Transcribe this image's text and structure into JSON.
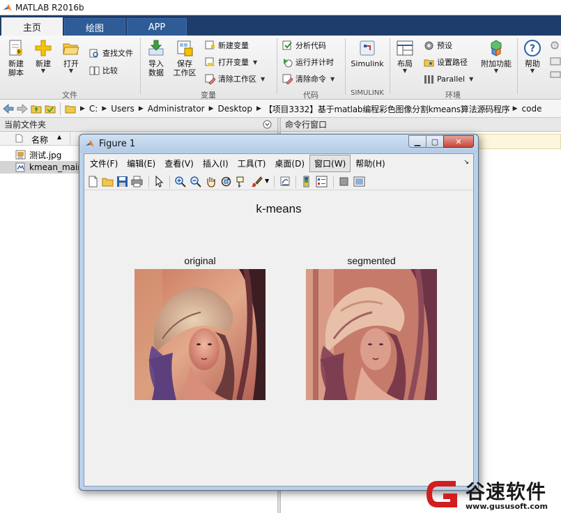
{
  "app": {
    "title": "MATLAB R2016b"
  },
  "ribbon_tabs": [
    "主页",
    "绘图",
    "APP"
  ],
  "ribbon": {
    "new_script": "新建\n脚本",
    "new": "新建",
    "open": "打开",
    "find_files": "查找文件",
    "compare": "比较",
    "group_file": "文件",
    "import_data": "导入\n数据",
    "save_workspace": "保存\n工作区",
    "new_variable": "新建变量",
    "open_variable": "打开变量",
    "clear_workspace": "清除工作区",
    "group_variable": "变量",
    "analyze_code": "分析代码",
    "run_and_time": "运行并计时",
    "clear_commands": "清除命令",
    "group_code": "代码",
    "simulink": "Simulink",
    "group_simulink": "SIMULINK",
    "layout": "布局",
    "preferences": "预设",
    "set_path": "设置路径",
    "parallel": "Parallel",
    "group_environment": "环境",
    "addons": "附加功能",
    "help": "帮助"
  },
  "address": {
    "crumbs": [
      "C:",
      "Users",
      "Administrator",
      "Desktop",
      "【项目3332】基于matlab编程彩色图像分割kmeans算法源码程序",
      "code"
    ]
  },
  "file_browser": {
    "title": "当前文件夹",
    "column_name": "名称",
    "files": [
      {
        "name": "测试.jpg",
        "icon": "jpg-file-icon"
      },
      {
        "name": "kmean_main",
        "icon": "m-file-icon"
      }
    ]
  },
  "command_window": {
    "title": "命令行窗口"
  },
  "figure": {
    "title": "Figure 1",
    "menu": [
      "文件(F)",
      "编辑(E)",
      "查看(V)",
      "插入(I)",
      "工具(T)",
      "桌面(D)",
      "窗口(W)",
      "帮助(H)"
    ],
    "highlighted_menu": "窗口(W)",
    "sgtitle": "k-means",
    "axes": [
      {
        "title": "original"
      },
      {
        "title": "segmented"
      }
    ]
  },
  "watermark": {
    "text": "谷速软件",
    "url": "www.gususoft.com"
  },
  "colors": {
    "tabbar": "#1f3d6a",
    "tab_active": "#f3f3f3",
    "watermark_red": "#d21e1e"
  }
}
